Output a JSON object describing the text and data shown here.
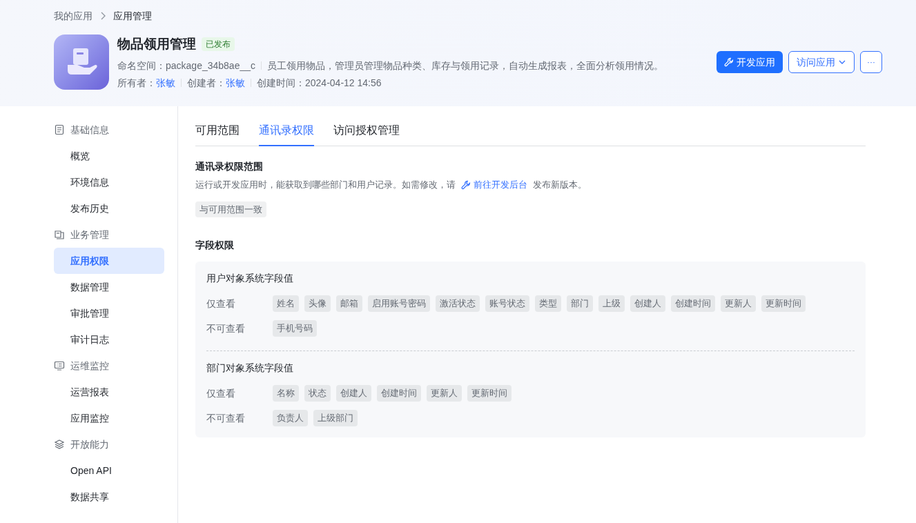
{
  "breadcrumb": [
    {
      "label": "我的应用"
    },
    {
      "label": "应用管理"
    }
  ],
  "app": {
    "name": "物品领用管理",
    "status": "已发布",
    "namespace_label": "命名空间：",
    "namespace": "package_34b8ae__c",
    "description": "员工领用物品，管理员管理物品种类、库存与领用记录，自动生成报表，全面分析领用情况。",
    "owner_label": "所有者：",
    "owner": "张敏",
    "creator_label": "创建者：",
    "creator": "张敏",
    "created_label": "创建时间：",
    "created": "2024-04-12 14:56"
  },
  "actions": {
    "develop": "开发应用",
    "visit": "访问应用",
    "more": "···"
  },
  "sidebar": [
    {
      "label": "基础信息",
      "children": [
        {
          "label": "概览",
          "selected": false
        },
        {
          "label": "环境信息",
          "selected": false
        },
        {
          "label": "发布历史",
          "selected": false
        }
      ]
    },
    {
      "label": "业务管理",
      "children": [
        {
          "label": "应用权限",
          "selected": true
        },
        {
          "label": "数据管理",
          "selected": false
        },
        {
          "label": "审批管理",
          "selected": false
        },
        {
          "label": "审计日志",
          "selected": false
        }
      ]
    },
    {
      "label": "运维监控",
      "children": [
        {
          "label": "运营报表",
          "selected": false
        },
        {
          "label": "应用监控",
          "selected": false
        }
      ]
    },
    {
      "label": "开放能力",
      "children": [
        {
          "label": "Open API",
          "selected": false
        },
        {
          "label": "数据共享",
          "selected": false
        }
      ]
    }
  ],
  "tabs": [
    {
      "label": "可用范围",
      "selected": false
    },
    {
      "label": "通讯录权限",
      "selected": true
    },
    {
      "label": "访问授权管理",
      "selected": false
    }
  ],
  "scope": {
    "title": "通讯录权限范围",
    "text_before": "运行或开发应用时，能获取到哪些部门和用户记录。如需修改，请",
    "link": "前往开发后台",
    "text_after": "发布新版本。",
    "tag": "与可用范围一致"
  },
  "field_permissions": {
    "title": "字段权限",
    "groups": [
      {
        "title": "用户对象系统字段值",
        "rows": [
          {
            "label": "仅查看",
            "tags": [
              "姓名",
              "头像",
              "邮箱",
              "启用账号密码",
              "激活状态",
              "账号状态",
              "类型",
              "部门",
              "上级",
              "创建人",
              "创建时间",
              "更新人",
              "更新时间"
            ]
          },
          {
            "label": "不可查看",
            "tags": [
              "手机号码"
            ]
          }
        ]
      },
      {
        "title": "部门对象系统字段值",
        "rows": [
          {
            "label": "仅查看",
            "tags": [
              "名称",
              "状态",
              "创建人",
              "创建时间",
              "更新人",
              "更新时间"
            ]
          },
          {
            "label": "不可查看",
            "tags": [
              "负责人",
              "上级部门"
            ]
          }
        ]
      }
    ]
  }
}
